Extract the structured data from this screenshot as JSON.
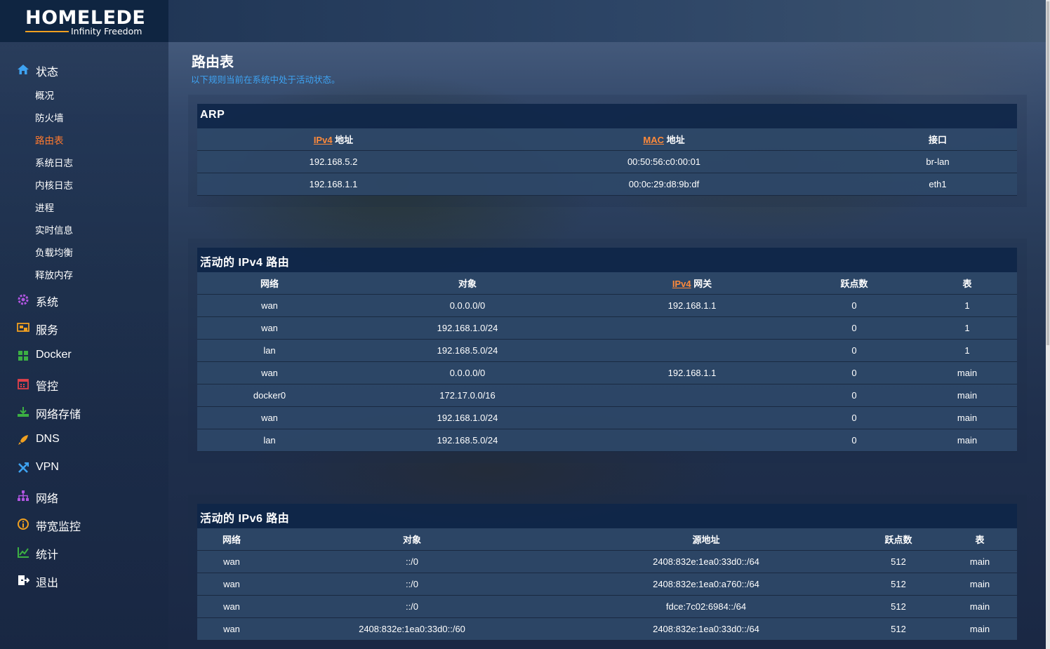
{
  "header": {
    "logo_main": "HOMELEDE",
    "logo_sub": "Infinity Freedom"
  },
  "sidebar": {
    "status": {
      "label": "状态",
      "icon": "home-icon",
      "children": [
        "概况",
        "防火墙",
        "路由表",
        "系统日志",
        "内核日志",
        "进程",
        "实时信息",
        "负载均衡",
        "释放内存"
      ],
      "active_child": "路由表"
    },
    "items": [
      {
        "label": "系统",
        "icon": "gear-icon",
        "color": "#b056e0"
      },
      {
        "label": "服务",
        "icon": "services-icon",
        "color": "#f0a020"
      },
      {
        "label": "Docker",
        "icon": "docker-icon",
        "color": "#3cb043"
      },
      {
        "label": "管控",
        "icon": "calendar-icon",
        "color": "#e0404a"
      },
      {
        "label": "网络存储",
        "icon": "download-icon",
        "color": "#3cb043"
      },
      {
        "label": "DNS",
        "icon": "rocket-icon",
        "color": "#f0a020"
      },
      {
        "label": "VPN",
        "icon": "vpn-icon",
        "color": "#3ea3f2"
      },
      {
        "label": "网络",
        "icon": "network-icon",
        "color": "#b056e0"
      },
      {
        "label": "带宽监控",
        "icon": "info-icon",
        "color": "#f0a020"
      },
      {
        "label": "统计",
        "icon": "chart-icon",
        "color": "#3cb043"
      },
      {
        "label": "退出",
        "icon": "logout-icon",
        "color": "#ffffff"
      }
    ]
  },
  "page": {
    "title": "路由表",
    "description": "以下规则当前在系统中处于活动状态。"
  },
  "arp": {
    "title": "ARP",
    "headers": {
      "ipv4_hl": "IPv4",
      "ipv4_rest": " 地址",
      "mac_hl": "MAC",
      "mac_rest": " 地址",
      "iface": "接口"
    },
    "rows": [
      {
        "ip": "192.168.5.2",
        "mac": "00:50:56:c0:00:01",
        "iface": "br-lan"
      },
      {
        "ip": "192.168.1.1",
        "mac": "00:0c:29:d8:9b:df",
        "iface": "eth1"
      }
    ]
  },
  "ipv4": {
    "title": "活动的 IPv4 路由",
    "headers": {
      "network": "网络",
      "target": "对象",
      "gw_hl": "IPv4",
      "gw_rest": " 网关",
      "metric": "跃点数",
      "table": "表"
    },
    "rows": [
      {
        "network": "wan",
        "target": "0.0.0.0/0",
        "gateway": "192.168.1.1",
        "metric": "0",
        "table": "1"
      },
      {
        "network": "wan",
        "target": "192.168.1.0/24",
        "gateway": "",
        "metric": "0",
        "table": "1"
      },
      {
        "network": "lan",
        "target": "192.168.5.0/24",
        "gateway": "",
        "metric": "0",
        "table": "1"
      },
      {
        "network": "wan",
        "target": "0.0.0.0/0",
        "gateway": "192.168.1.1",
        "metric": "0",
        "table": "main"
      },
      {
        "network": "docker0",
        "target": "172.17.0.0/16",
        "gateway": "",
        "metric": "0",
        "table": "main"
      },
      {
        "network": "wan",
        "target": "192.168.1.0/24",
        "gateway": "",
        "metric": "0",
        "table": "main"
      },
      {
        "network": "lan",
        "target": "192.168.5.0/24",
        "gateway": "",
        "metric": "0",
        "table": "main"
      }
    ]
  },
  "ipv6": {
    "title": "活动的 IPv6 路由",
    "headers": {
      "network": "网络",
      "target": "对象",
      "source": "源地址",
      "metric": "跃点数",
      "table": "表"
    },
    "rows": [
      {
        "network": "wan",
        "target": "::/0",
        "source": "2408:832e:1ea0:33d0::/64",
        "metric": "512",
        "table": "main"
      },
      {
        "network": "wan",
        "target": "::/0",
        "source": "2408:832e:1ea0:a760::/64",
        "metric": "512",
        "table": "main"
      },
      {
        "network": "wan",
        "target": "::/0",
        "source": "fdce:7c02:6984::/64",
        "metric": "512",
        "table": "main"
      },
      {
        "network": "wan",
        "target": "2408:832e:1ea0:33d0::/60",
        "source": "2408:832e:1ea0:33d0::/64",
        "metric": "512",
        "table": "main"
      }
    ]
  }
}
